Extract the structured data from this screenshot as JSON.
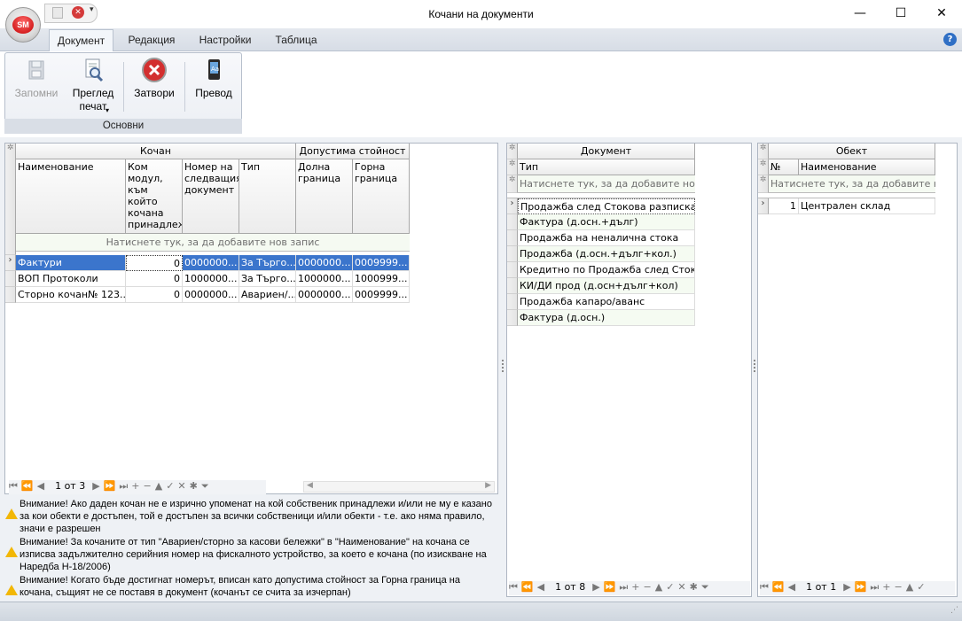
{
  "window": {
    "title": "Кочани на документи",
    "app_badge": "SM",
    "minimize_glyph": "—",
    "maximize_glyph": "☐",
    "close_glyph": "✕",
    "help_glyph": "?"
  },
  "tabs": [
    "Документ",
    "Редакция",
    "Настройки",
    "Таблица"
  ],
  "ribbon": {
    "group_label": "Основни",
    "save": "Запомни",
    "preview_line1": "Преглед",
    "preview_line2": "печат",
    "close": "Затвори",
    "translate": "Превод"
  },
  "kochan_grid": {
    "band1": "Кочан",
    "band2": "Допустима стойност",
    "columns": [
      "Наименование",
      "Ком модул, към който кочана принадлеж и в МОМЕНТА",
      "Номер на следващия документ",
      "Тип",
      "Долна граница",
      "Горна граница"
    ],
    "new_row": "Натиснете тук, за да добавите нов запис",
    "rows": [
      [
        "Фактури",
        "0",
        "0000000...",
        "За Търго...",
        "0000000...",
        "0009999..."
      ],
      [
        "ВОП Протоколи",
        "0",
        "1000000...",
        "За Търго...",
        "1000000...",
        "1000999..."
      ],
      [
        "Сторно кочан№ 123...",
        "0",
        "0000000...",
        "Авариен/...",
        "0000000...",
        "0009999..."
      ]
    ],
    "pager": "1 от 3"
  },
  "document_grid": {
    "band": "Документ",
    "column": "Тип",
    "new_row": "Натиснете тук, за да добавите нов запис",
    "rows": [
      "Продажба след Стокова разписка",
      "Фактура (д.осн.+дълг)",
      "Продажба на неналична стока",
      "Продажба (д.осн.+дълг+кол.)",
      "Кредитно по Продажба след Сток",
      "КИ/ДИ прод (д.осн+дълг+кол)",
      "Продажба капаро/аванс",
      "Фактура (д.осн.)"
    ],
    "pager": "1 от 8"
  },
  "object_grid": {
    "band": "Обект",
    "col_no": "№",
    "col_name": "Наименование",
    "new_row": "Натиснете тук, за да добавите нов запис",
    "rows": [
      [
        "1",
        "Централен склад"
      ]
    ],
    "pager": "1 от 1"
  },
  "warnings": [
    "Внимание! Ако даден кочан не е изрично упоменат на кой собственик принадлежи и/или не му е казано за кои обекти е достъпен, той е достъпен за всички собственици и/или обекти - т.е. ако няма правило, значи е разрешен",
    "Внимание! За кочаните от тип \"Авариен/сторно за касови бележки\" в \"Наименование\" на кочана се изписва задължително серийния номер на фискалното устройство, за което е кочана (по изискване на Наредба Н-18/2006)",
    "Внимание! Когато бъде достигнат номерът, вписан като допустима стойност за Горна граница на кочана, същият не се поставя в документ (кочанът се счита за изчерпан)"
  ],
  "colors": {
    "selection": "#3b75cc",
    "warning": "#f2b705",
    "accent": "#2f6fc5"
  }
}
